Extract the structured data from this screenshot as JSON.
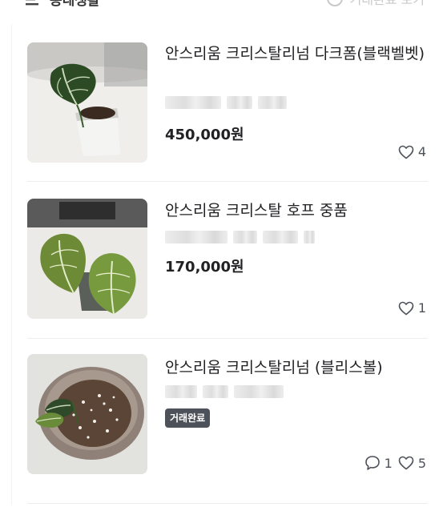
{
  "header": {
    "left_label": "동네생활",
    "right_label": "거래완료 보기"
  },
  "listings": [
    {
      "title": "안스리움 크리스탈리넘 다크폼(블랙벨벳)",
      "price": "450,000원",
      "status_badge": null,
      "chat_count": null,
      "like_count": "4"
    },
    {
      "title": "안스리움 크리스탈 호프 중품",
      "price": "170,000원",
      "status_badge": null,
      "chat_count": null,
      "like_count": "1"
    },
    {
      "title": "안스리움 크리스탈리넘 (블리스볼)",
      "price": null,
      "status_badge": "거래완료",
      "chat_count": "1",
      "like_count": "5"
    }
  ],
  "icons": {
    "like": "heart-outline-icon",
    "chat": "chat-bubble-icon"
  },
  "colors": {
    "text": "#212124",
    "meta": "#4d5159",
    "badge_bg": "#4d5159",
    "divider": "#ededed"
  }
}
